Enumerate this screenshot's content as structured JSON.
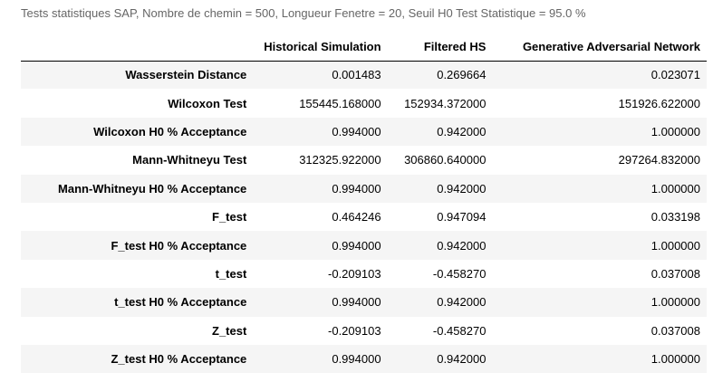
{
  "caption": "Tests statistiques SAP, Nombre de chemin = 500, Longueur Fenetre = 20, Seuil H0 Test Statistique = 95.0 %",
  "table": {
    "columns": [
      "Historical Simulation",
      "Filtered HS",
      "Generative Adversarial Network"
    ],
    "rows": [
      {
        "label": "Wasserstein Distance",
        "values": [
          "0.001483",
          "0.269664",
          "0.023071"
        ]
      },
      {
        "label": "Wilcoxon Test",
        "values": [
          "155445.168000",
          "152934.372000",
          "151926.622000"
        ]
      },
      {
        "label": "Wilcoxon H0 % Acceptance",
        "values": [
          "0.994000",
          "0.942000",
          "1.000000"
        ]
      },
      {
        "label": "Mann-Whitneyu Test",
        "values": [
          "312325.922000",
          "306860.640000",
          "297264.832000"
        ]
      },
      {
        "label": "Mann-Whitneyu H0 % Acceptance",
        "values": [
          "0.994000",
          "0.942000",
          "1.000000"
        ]
      },
      {
        "label": "F_test",
        "values": [
          "0.464246",
          "0.947094",
          "0.033198"
        ]
      },
      {
        "label": "F_test H0 % Acceptance",
        "values": [
          "0.994000",
          "0.942000",
          "1.000000"
        ]
      },
      {
        "label": "t_test",
        "values": [
          "-0.209103",
          "-0.458270",
          "0.037008"
        ]
      },
      {
        "label": "t_test H0 % Acceptance",
        "values": [
          "0.994000",
          "0.942000",
          "1.000000"
        ]
      },
      {
        "label": "Z_test",
        "values": [
          "-0.209103",
          "-0.458270",
          "0.037008"
        ]
      },
      {
        "label": "Z_test H0 % Acceptance",
        "values": [
          "0.994000",
          "0.942000",
          "1.000000"
        ]
      }
    ]
  }
}
